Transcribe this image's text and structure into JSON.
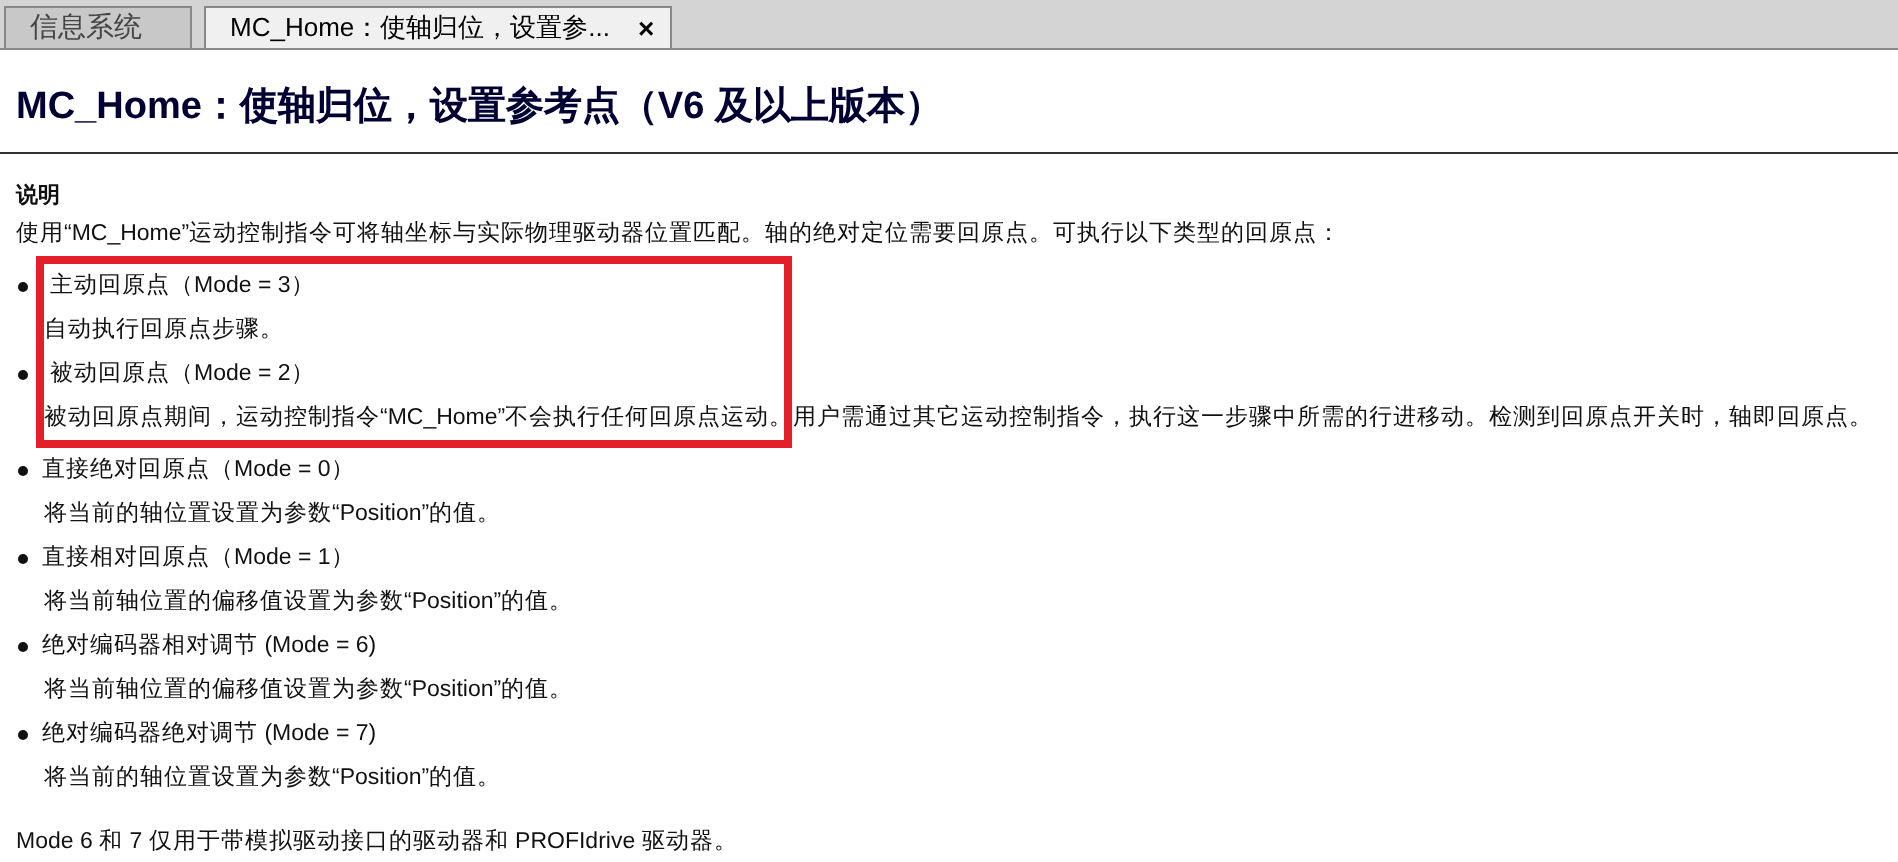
{
  "tabs": [
    {
      "label": "信息系统",
      "selected": false
    },
    {
      "label": "MC_Home：使轴归位，设置参...",
      "selected": true,
      "close": "×"
    }
  ],
  "heading": "MC_Home：使轴归位，设置参考点（V6 及以上版本）",
  "section_title": "说明",
  "intro": "使用“MC_Home”运动控制指令可将轴坐标与实际物理驱动器位置匹配。轴的绝对定位需要回原点。可执行以下类型的回原点：",
  "items": [
    {
      "title": "主动回原点（Mode = 3）",
      "description": "自动执行回原点步骤。",
      "highlighted": true
    },
    {
      "title": "被动回原点（Mode = 2）",
      "description": "被动回原点期间，运动控制指令“MC_Home”不会执行任何回原点运动。用户需通过其它运动控制指令，执行这一步骤中所需的行进移动。检测到回原点开关时，轴即回原点。",
      "highlighted": true
    },
    {
      "title": "直接绝对回原点（Mode = 0）",
      "description": "将当前的轴位置设置为参数“Position”的值。",
      "highlighted": false
    },
    {
      "title": "直接相对回原点（Mode = 1）",
      "description": "将当前轴位置的偏移值设置为参数“Position”的值。",
      "highlighted": false
    },
    {
      "title": "绝对编码器相对调节 (Mode = 6)",
      "description": "将当前轴位置的偏移值设置为参数“Position”的值。",
      "highlighted": false
    },
    {
      "title": "绝对编码器绝对调节 (Mode = 7)",
      "description": "将当前的轴位置设置为参数“Position”的值。",
      "highlighted": false
    }
  ],
  "note": "Mode 6 和 7 仅用于带模拟驱动接口的驱动器和 PROFIdrive 驱动器。"
}
